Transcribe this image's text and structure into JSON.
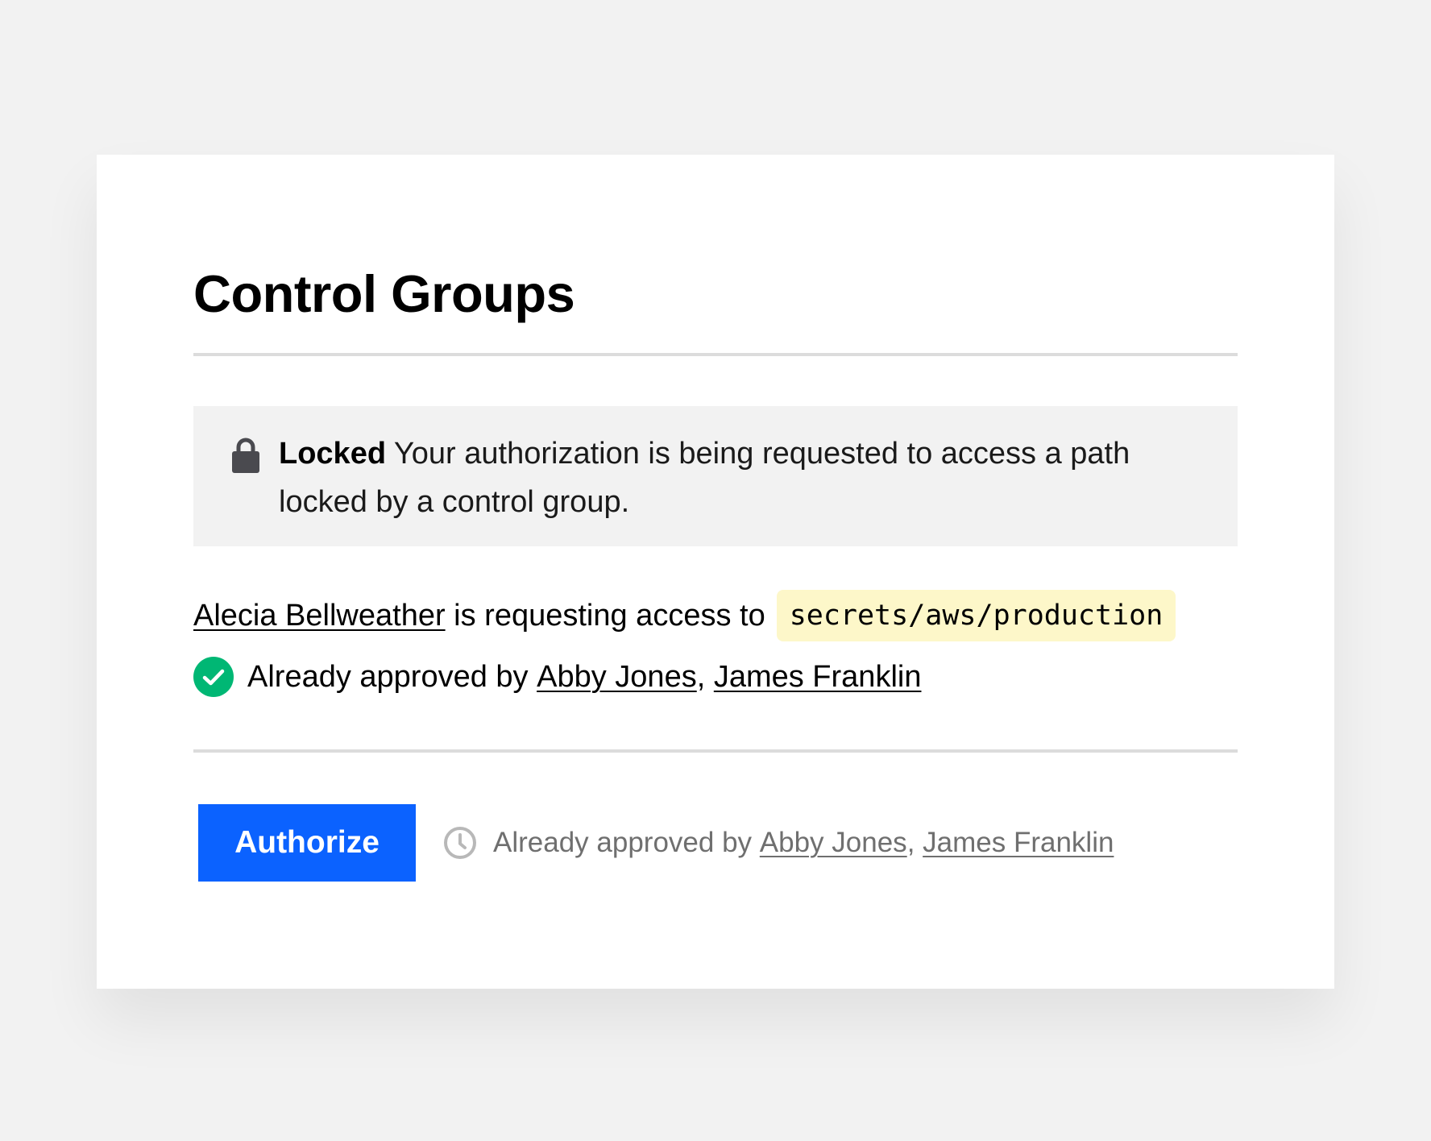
{
  "header": {
    "title": "Control Groups"
  },
  "notice": {
    "icon": "lock-icon",
    "strong": "Locked",
    "message": "Your authorization is being requested to access a path locked by a control group."
  },
  "request": {
    "requester": "Alecia Bellweather",
    "text": "is requesting access to",
    "path": "secrets/aws/production"
  },
  "approval": {
    "icon": "check-circle-icon",
    "prefix": "Already approved by",
    "approvers": [
      "Abby Jones",
      "James Franklin"
    ],
    "separator": ","
  },
  "actions": {
    "authorize_label": "Authorize"
  },
  "footer_status": {
    "icon": "clock-icon",
    "prefix": "Already approved by",
    "approvers": [
      "Abby Jones",
      "James Franklin"
    ],
    "separator": ","
  },
  "colors": {
    "background": "#f2f2f2",
    "card": "#ffffff",
    "primary_button": "#0b62ff",
    "success": "#00b774",
    "code_highlight": "#fdf7c9",
    "muted_text": "#6f6f6f",
    "lock_icon": "#4a4a4f"
  }
}
